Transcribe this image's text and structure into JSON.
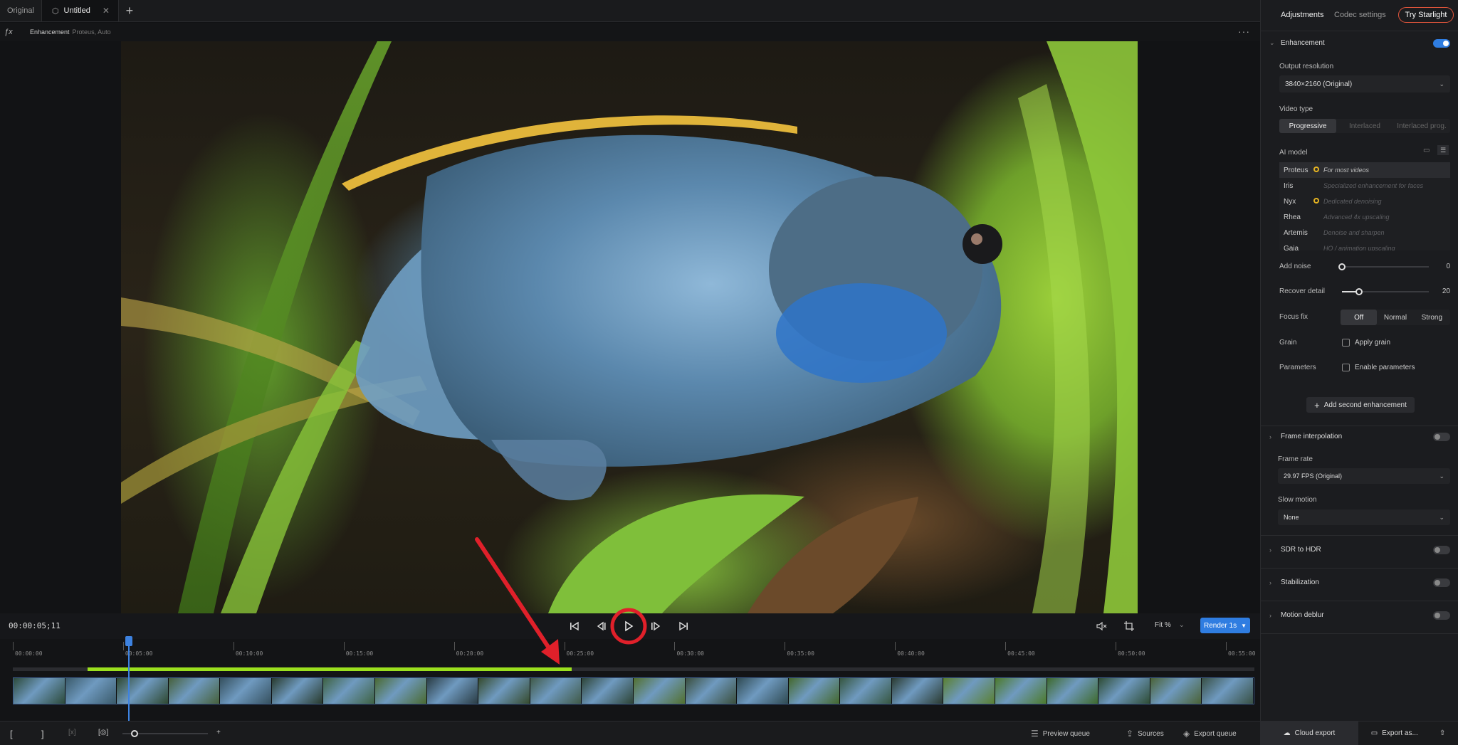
{
  "tabs": {
    "original": "Original",
    "active": "Untitled",
    "add": "+"
  },
  "subbar": {
    "fx": "ƒx",
    "title": "Enhancement",
    "detail": "Proteus, Auto",
    "more": "···"
  },
  "transport": {
    "timecode": "00:00:05;11",
    "fit": "Fit %",
    "render": "Render 1s"
  },
  "timeline": {
    "ticks": [
      "00:00:00",
      "00:05:00",
      "00:10:00",
      "00:15:00",
      "00:20:00",
      "00:25:00",
      "00:30:00",
      "00:35:00",
      "00:40:00",
      "00:45:00",
      "00:50:00",
      "00:55:00"
    ],
    "progress_start_fraction": 0.06,
    "progress_end_fraction": 0.45,
    "playhead_fraction": 0.093
  },
  "bottom": {
    "preview_queue": "Preview queue",
    "sources": "Sources",
    "export_queue": "Export queue",
    "cloud_export": "Cloud export",
    "export_as": "Export as..."
  },
  "panel": {
    "tab_adjustments": "Adjustments",
    "tab_codec": "Codec settings",
    "try_starlight": "Try Starlight",
    "enhancement": {
      "title": "Enhancement",
      "enabled": true,
      "output_resolution_label": "Output resolution",
      "output_resolution": "3840×2160 (Original)",
      "video_type_label": "Video type",
      "video_types": [
        "Progressive",
        "Interlaced",
        "Interlaced prog."
      ],
      "video_type_selected": 0,
      "ai_model_label": "AI model",
      "models": [
        {
          "name": "Proteus",
          "desc": "For most videos",
          "dot": true
        },
        {
          "name": "Iris",
          "desc": "Specialized enhancement for faces",
          "dot": false
        },
        {
          "name": "Nyx",
          "desc": "Dedicated denoising",
          "dot": true
        },
        {
          "name": "Rhea",
          "desc": "Advanced 4x upscaling",
          "dot": false
        },
        {
          "name": "Artemis",
          "desc": "Denoise and sharpen",
          "dot": false
        },
        {
          "name": "Gaia",
          "desc": "HQ / animation upscaling",
          "dot": false
        }
      ],
      "add_noise_label": "Add noise",
      "add_noise": 0,
      "recover_detail_label": "Recover detail",
      "recover_detail": 20,
      "focus_fix_label": "Focus fix",
      "focus_fix_options": [
        "Off",
        "Normal",
        "Strong"
      ],
      "grain_label": "Grain",
      "grain_check": "Apply grain",
      "parameters_label": "Parameters",
      "parameters_check": "Enable parameters",
      "add_second": "Add second enhancement"
    },
    "frame_interpolation": {
      "title": "Frame interpolation",
      "frame_rate_label": "Frame rate",
      "frame_rate": "29.97 FPS (Original)",
      "slow_motion_label": "Slow motion",
      "slow_motion": "None"
    },
    "sdr_to_hdr": "SDR to HDR",
    "stabilization": "Stabilization",
    "motion_deblur": "Motion deblur"
  },
  "colors": {
    "accent": "#2f7de1",
    "progress": "#9be01e",
    "annotation": "#e0202a",
    "starlight_border": "#e2553b"
  }
}
